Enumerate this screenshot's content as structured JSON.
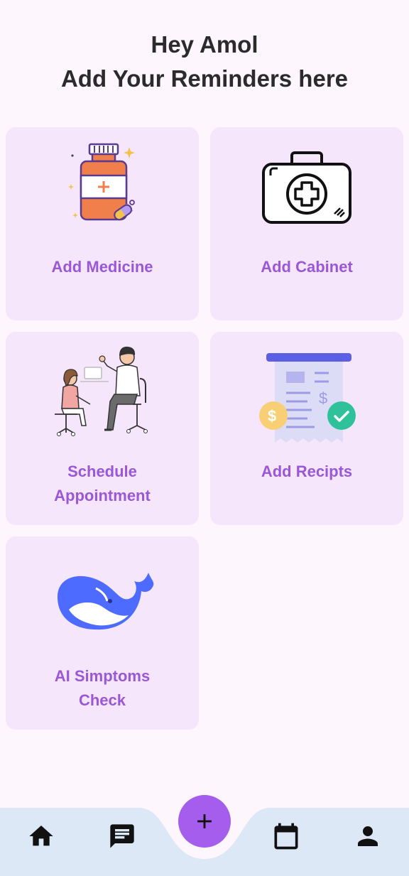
{
  "header": {
    "greeting": "Hey Amol",
    "subtitle": "Add Your Reminders here"
  },
  "cards": [
    {
      "label": "Add Medicine",
      "icon": "medicine-bottle-icon"
    },
    {
      "label": "Add Cabinet",
      "icon": "first-aid-kit-icon"
    },
    {
      "label_line1": "Schedule",
      "label_line2": "Appointment",
      "icon": "doctor-consultation-illustration"
    },
    {
      "label": "Add Recipts",
      "icon": "receipt-icon"
    },
    {
      "label_line1": "AI Simptoms",
      "label_line2": "Check",
      "icon": "whale-logo-icon"
    }
  ],
  "nav": {
    "items": [
      "home-icon",
      "chat-icon",
      "add-icon",
      "calendar-icon",
      "person-icon"
    ]
  },
  "colors": {
    "background": "#fdf7fd",
    "card": "#f5e6fb",
    "label": "#9a57d6",
    "fab": "#a55ded",
    "navbar": "#dce8f5"
  }
}
